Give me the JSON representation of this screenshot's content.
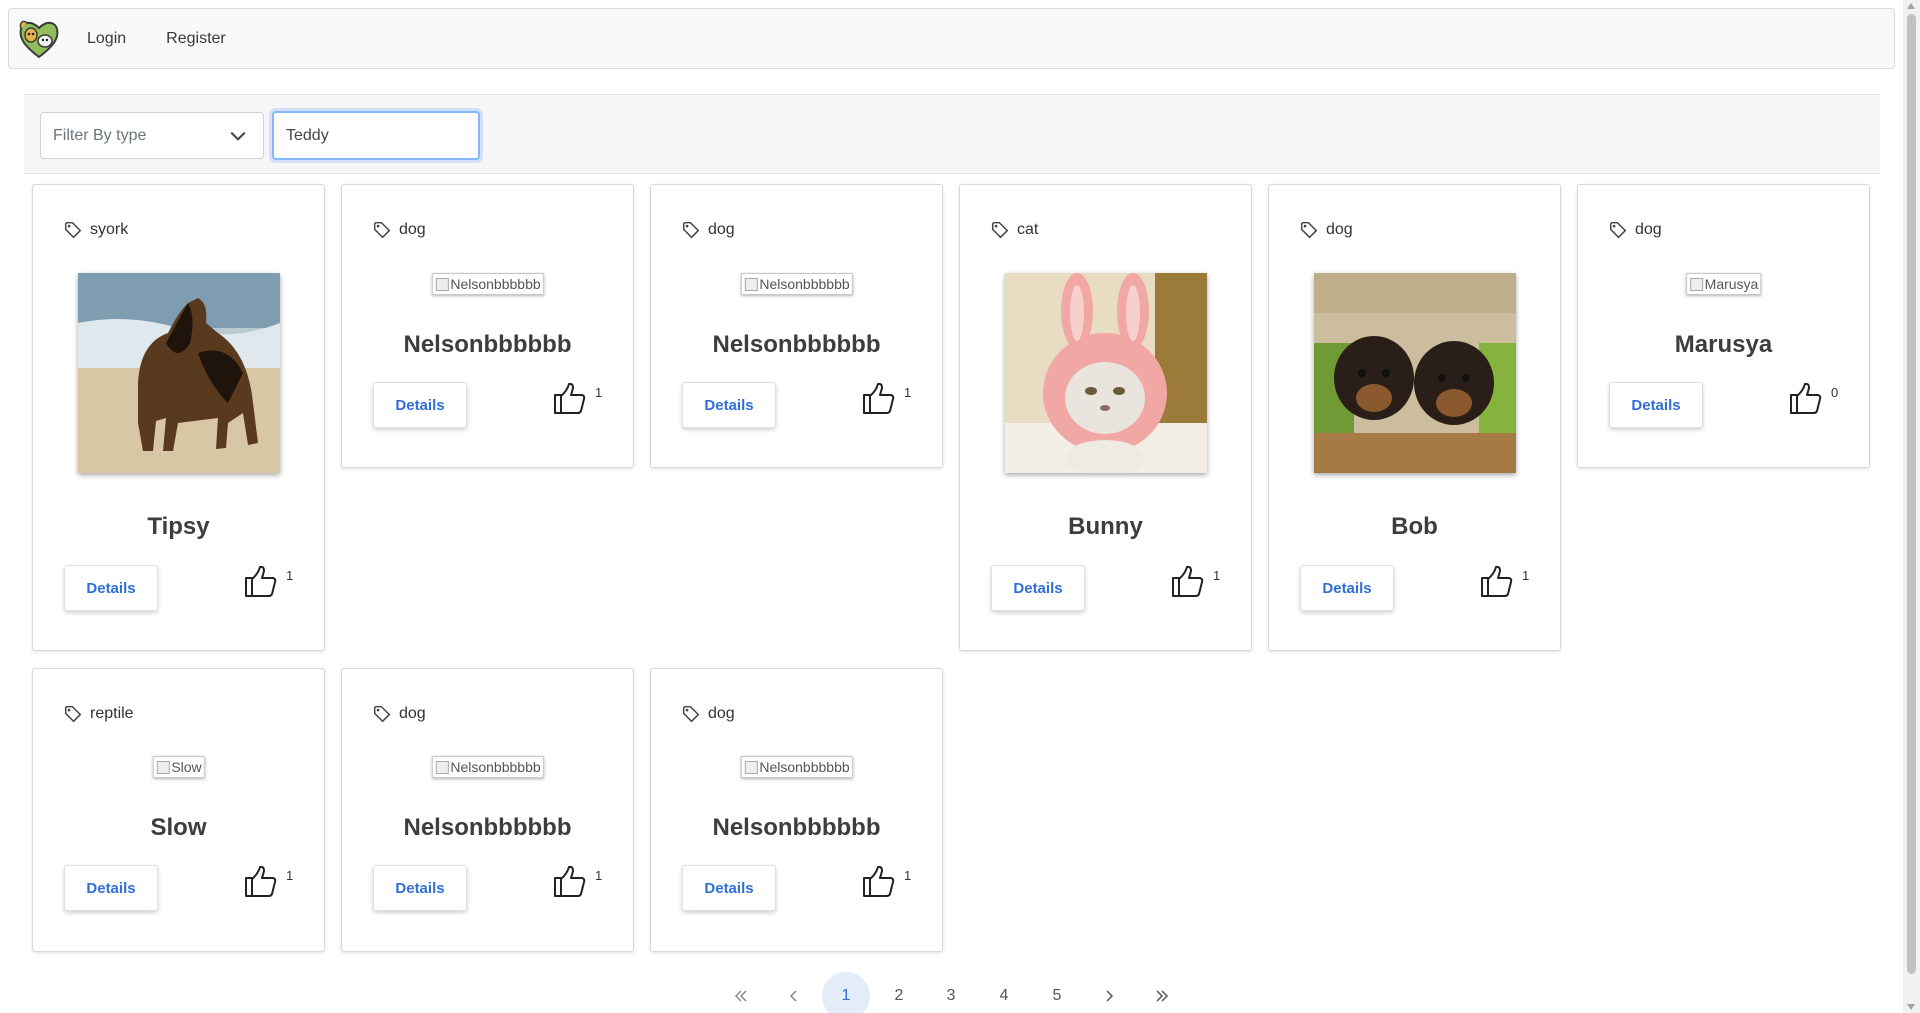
{
  "navbar": {
    "logo_icon": "pet-logo-icon",
    "links": [
      {
        "label": "Login"
      },
      {
        "label": "Register"
      }
    ]
  },
  "filter": {
    "type_select_placeholder": "Filter By type",
    "search_value": "Teddy"
  },
  "pets": [
    {
      "type": "syork",
      "name": "Tipsy",
      "image": "german-shepherd-photo",
      "image_alt": "",
      "likes": "1",
      "details_label": "Details"
    },
    {
      "type": "dog",
      "name": "Nelsonbbbbbb",
      "image": null,
      "image_alt": "Nelsonbbbbbb",
      "likes": "1",
      "details_label": "Details"
    },
    {
      "type": "dog",
      "name": "Nelsonbbbbbb",
      "image": null,
      "image_alt": "Nelsonbbbbbb",
      "likes": "1",
      "details_label": "Details"
    },
    {
      "type": "cat",
      "name": "Bunny",
      "image": "cat-bunny-hat-photo",
      "image_alt": "",
      "likes": "1",
      "details_label": "Details"
    },
    {
      "type": "dog",
      "name": "Bob",
      "image": "rottweiler-puppies-photo",
      "image_alt": "",
      "likes": "1",
      "details_label": "Details"
    },
    {
      "type": "dog",
      "name": "Marusya",
      "image": null,
      "image_alt": "Marusya",
      "likes": "0",
      "details_label": "Details"
    },
    {
      "type": "reptile",
      "name": "Slow",
      "image": null,
      "image_alt": "Slow",
      "likes": "1",
      "details_label": "Details"
    },
    {
      "type": "dog",
      "name": "Nelsonbbbbbb",
      "image": null,
      "image_alt": "Nelsonbbbbbb",
      "likes": "1",
      "details_label": "Details"
    },
    {
      "type": "dog",
      "name": "Nelsonbbbbbb",
      "image": null,
      "image_alt": "Nelsonbbbbbb",
      "likes": "1",
      "details_label": "Details"
    }
  ],
  "pagination": {
    "first_icon": "double-chevron-left-icon",
    "prev_icon": "chevron-left-icon",
    "pages": [
      "1",
      "2",
      "3",
      "4",
      "5"
    ],
    "active_page": "1",
    "next_icon": "chevron-right-icon",
    "last_icon": "double-chevron-right-icon"
  },
  "colors": {
    "accent": "#2f6fd6",
    "navbar_bg": "#f8f9fa",
    "active_page_bg": "#e3ecf8"
  }
}
